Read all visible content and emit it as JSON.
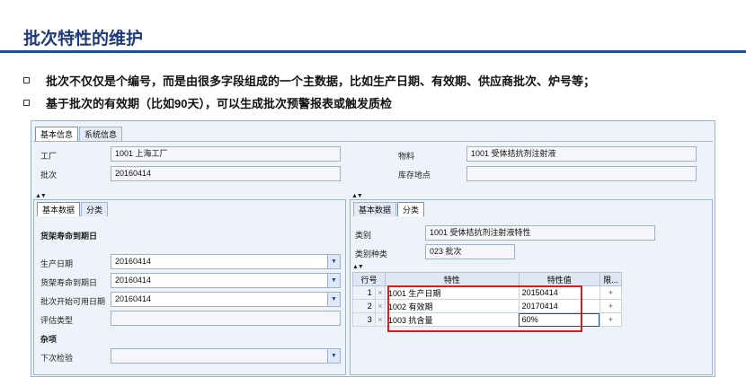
{
  "slide": {
    "title": "批次特性的维护",
    "bullets": [
      "批次不仅仅是个编号，而是由很多字段组成的一个主数据，比如生产日期、有效期、供应商批次、炉号等；",
      "基于批次的有效期（比如90天），可以生成批次预警报表或触发质检"
    ]
  },
  "top_tabs": [
    "基本信息",
    "系统信息"
  ],
  "header": {
    "plant_label": "工厂",
    "plant_value": "1001 上海工厂",
    "batch_label": "批次",
    "batch_value": "20160414",
    "material_label": "物料",
    "material_value": "1001 受体拮抗剂注射液",
    "storage_label": "库存地点",
    "storage_value": ""
  },
  "left_tabs": [
    "基本数据",
    "分类"
  ],
  "left": {
    "section1": "货架寿命到期日",
    "fields": [
      {
        "label": "生产日期",
        "value": "20160414"
      },
      {
        "label": "货架寿命到期日",
        "value": "20160414"
      },
      {
        "label": "批次开始可用日期",
        "value": "20160414"
      },
      {
        "label": "评估类型",
        "value": ""
      }
    ],
    "section2": "杂项",
    "next_check_label": "下次检验",
    "next_check_value": ""
  },
  "right_tabs": [
    "基本数据",
    "分类"
  ],
  "right": {
    "class_label": "类别",
    "class_value": "1001  受体拮抗剂注射液特性",
    "class_type_label": "类别种类",
    "class_type_value": "023 批次",
    "table": {
      "headers": [
        "行号",
        "特性",
        "特性值",
        "限..."
      ],
      "rows": [
        {
          "n": "1",
          "char": "1001 生产日期",
          "value": "20150414"
        },
        {
          "n": "2",
          "char": "1002 有效期",
          "value": "20170414"
        },
        {
          "n": "3",
          "char": "1003 抗含量",
          "value": "60%"
        }
      ]
    }
  },
  "icons": {
    "dropdown": "chevron-down-icon",
    "add": "plus-icon",
    "row_marker": "row-x-icon",
    "split": "split-arrows-icon"
  }
}
